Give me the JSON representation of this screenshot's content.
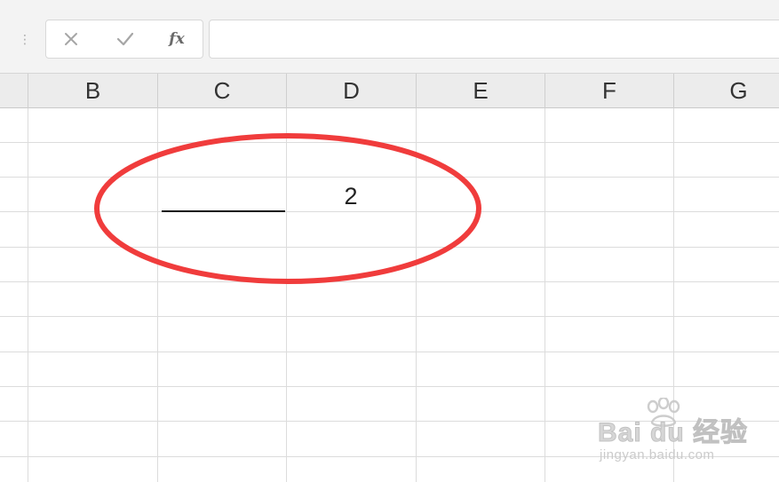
{
  "formula_bar": {
    "cancel_icon": "close-x",
    "confirm_icon": "checkmark",
    "function_label": "fx",
    "formula_value": ""
  },
  "columns": [
    {
      "label": "B"
    },
    {
      "label": "C"
    },
    {
      "label": "D"
    },
    {
      "label": "E"
    },
    {
      "label": "F"
    },
    {
      "label": "G"
    }
  ],
  "cells": {
    "D3": "2"
  },
  "annotation": {
    "shape": "ellipse",
    "color": "#f03c3c"
  },
  "watermark": {
    "logo": "Bai du 经验",
    "url": "jingyan.baidu.com"
  },
  "colors": {
    "header_bg": "#ececec",
    "grid_line": "#dcdcdc",
    "annotation_red": "#f03c3c"
  }
}
